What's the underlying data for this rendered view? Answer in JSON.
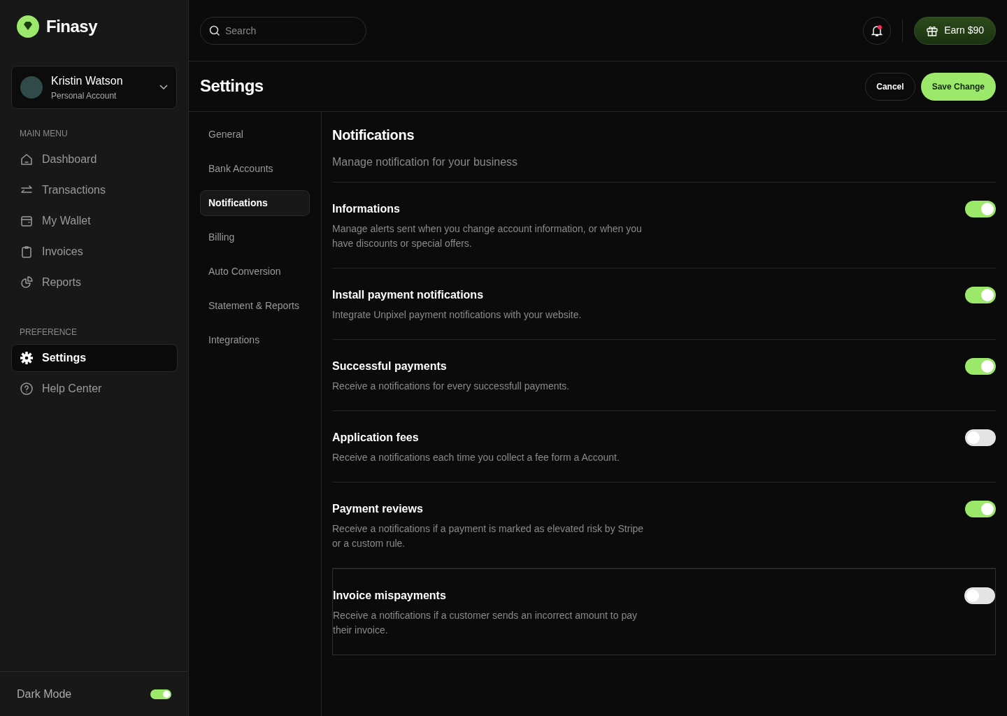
{
  "brand": "Finasy",
  "account": {
    "name": "Kristin Watson",
    "type": "Personal Account"
  },
  "main_menu": {
    "heading": "MAIN MENU",
    "items": [
      {
        "kind": "home",
        "label": "Dashboard",
        "selected": false
      },
      {
        "kind": "transfer",
        "label": "Transactions",
        "selected": false
      },
      {
        "kind": "wallet",
        "label": "My Wallet",
        "selected": false
      },
      {
        "kind": "clipboard",
        "label": "Invoices",
        "selected": false
      },
      {
        "kind": "chart",
        "label": "Reports",
        "selected": false
      }
    ]
  },
  "preference": {
    "heading": "PREFERENCE",
    "items": [
      {
        "kind": "gear",
        "label": "Settings",
        "selected": true
      },
      {
        "kind": "help",
        "label": "Help Center",
        "selected": false
      }
    ]
  },
  "dark_mode": {
    "label": "Dark Mode",
    "on": true
  },
  "search": {
    "placeholder": "Search"
  },
  "notifications_unread": true,
  "earn_button": "Earn $90",
  "page_title": "Settings",
  "buttons": {
    "cancel": "Cancel",
    "save": "Save Change"
  },
  "settings_nav": [
    {
      "label": "General",
      "selected": false
    },
    {
      "label": "Bank Accounts",
      "selected": false
    },
    {
      "label": "Notifications",
      "selected": true
    },
    {
      "label": "Billing",
      "selected": false
    },
    {
      "label": "Auto Conversion",
      "selected": false
    },
    {
      "label": "Statement & Reports",
      "selected": false
    },
    {
      "label": "Integrations",
      "selected": false
    }
  ],
  "section": {
    "title": "Notifications",
    "subtitle": "Manage notification for your business"
  },
  "options": [
    {
      "title": "Informations",
      "description": "Manage alerts sent when you change account information, or when you have discounts or special offers.",
      "on": true,
      "outlined": false
    },
    {
      "title": "Install payment notifications",
      "description": "Integrate Unpixel payment notifications with your website.",
      "on": true,
      "outlined": false
    },
    {
      "title": "Successful payments",
      "description": "Receive a notifications for every successfull payments.",
      "on": true,
      "outlined": false
    },
    {
      "title": "Application fees",
      "description": "Receive a notifications each time you collect a fee form a Account.",
      "on": false,
      "outlined": false
    },
    {
      "title": "Payment reviews",
      "description": "Receive a notifications if a payment is marked as elevated risk by Stripe or a custom rule.",
      "on": true,
      "outlined": false
    },
    {
      "title": "Invoice mispayments",
      "description": "Receive a notifications if a customer sends an incorrect amount to pay their invoice.",
      "on": false,
      "outlined": true
    }
  ]
}
